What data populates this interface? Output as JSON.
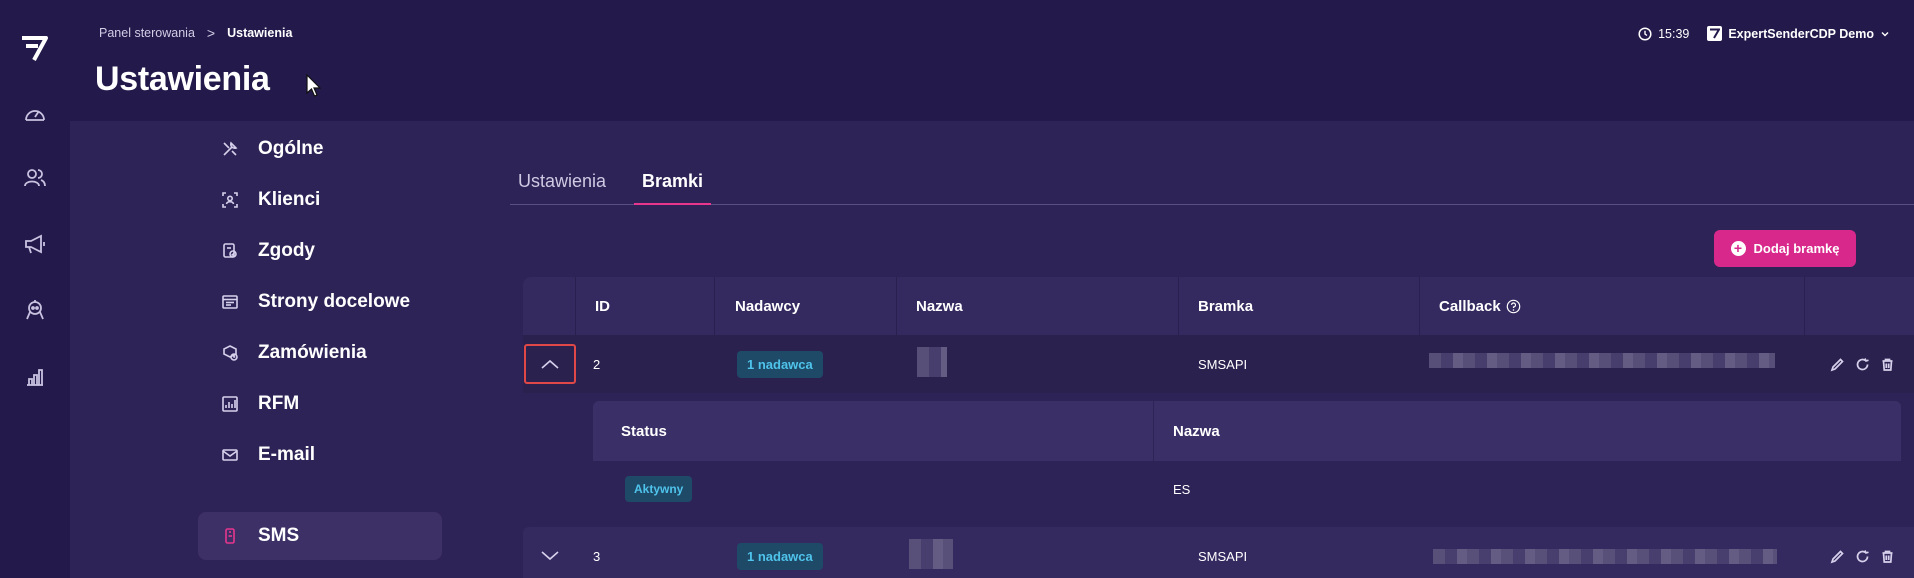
{
  "breadcrumb": {
    "root": "Panel sterowania",
    "separator": ">",
    "current": "Ustawienia"
  },
  "page": {
    "title": "Ustawienia"
  },
  "topbar": {
    "time": "15:39",
    "account": "ExpertSenderCDP Demo"
  },
  "settings_nav": [
    {
      "label": "Ogólne",
      "icon": "tools-icon"
    },
    {
      "label": "Klienci",
      "icon": "customer-icon"
    },
    {
      "label": "Zgody",
      "icon": "consent-icon"
    },
    {
      "label": "Strony docelowe",
      "icon": "landing-page-icon"
    },
    {
      "label": "Zamówienia",
      "icon": "orders-icon"
    },
    {
      "label": "RFM",
      "icon": "rfm-chart-icon"
    },
    {
      "label": "E-mail",
      "icon": "mail-icon"
    },
    {
      "label": "SMS",
      "icon": "sms-icon",
      "active": true
    }
  ],
  "tabs": [
    {
      "label": "Ustawienia"
    },
    {
      "label": "Bramki",
      "active": true
    }
  ],
  "add_button": {
    "label": "Dodaj bramkę"
  },
  "table": {
    "columns": [
      "ID",
      "Nadawcy",
      "Nazwa",
      "Bramka",
      "Callback"
    ],
    "rows": [
      {
        "id": "2",
        "senders": "1 nadawca",
        "gateway": "SMSAPI",
        "expanded": true
      },
      {
        "id": "3",
        "senders": "1 nadawca",
        "gateway": "SMSAPI",
        "expanded": false
      }
    ]
  },
  "subtable": {
    "columns": [
      "Status",
      "Nazwa"
    ],
    "rows": [
      {
        "status": "Aktywny",
        "name": "ES"
      }
    ]
  },
  "colors": {
    "accent": "#d9288c",
    "badge_text": "#4fc3ea",
    "highlight": "#e04848"
  }
}
